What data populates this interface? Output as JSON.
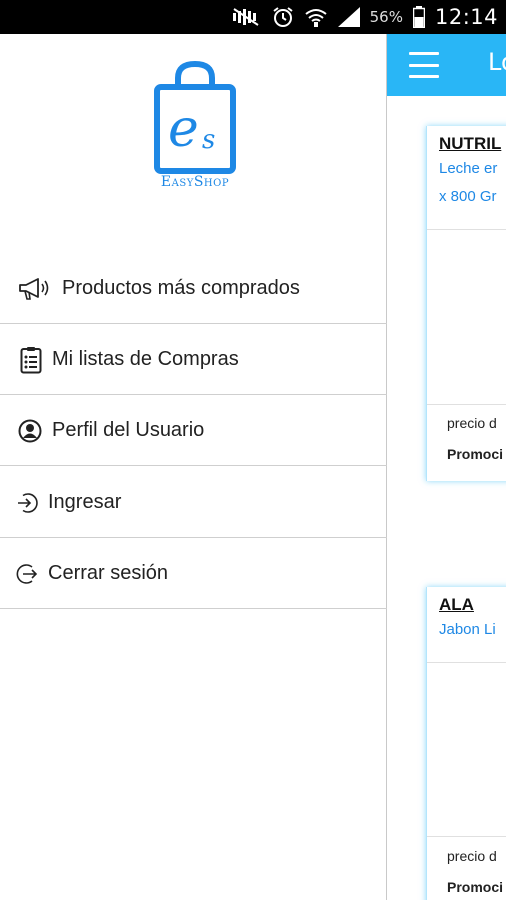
{
  "status_bar": {
    "battery_percent": "56%",
    "time": "12:14",
    "icons": [
      "mute-icon",
      "alarm-icon",
      "wifi-icon",
      "signal-icon",
      "battery-icon"
    ]
  },
  "app_bar": {
    "title": "Lo",
    "menu_icon": "hamburger-menu-icon",
    "color": "#29b6f6"
  },
  "drawer": {
    "logo_text": "EasyShop",
    "logo_letters": "es",
    "items": [
      {
        "label": "Productos más comprados",
        "icon": "megaphone-icon"
      },
      {
        "label": "Mi listas de Compras",
        "icon": "clipboard-list-icon"
      },
      {
        "label": "Perfil del Usuario",
        "icon": "user-profile-icon"
      },
      {
        "label": "Ingresar",
        "icon": "login-icon"
      },
      {
        "label": "Cerrar sesión",
        "icon": "logout-icon"
      }
    ]
  },
  "products": [
    {
      "brand": "NUTRIL",
      "desc_line1": "Leche er",
      "desc_line2": "x 800 Gr",
      "price_label": "precio d",
      "promo_label": "Promoci"
    },
    {
      "brand": "ALA",
      "desc_line1": "Jabon Li",
      "price_label": "precio d",
      "promo_label": "Promoci"
    }
  ],
  "colors": {
    "accent": "#29b6f6",
    "logo_blue": "#1e88e5"
  }
}
